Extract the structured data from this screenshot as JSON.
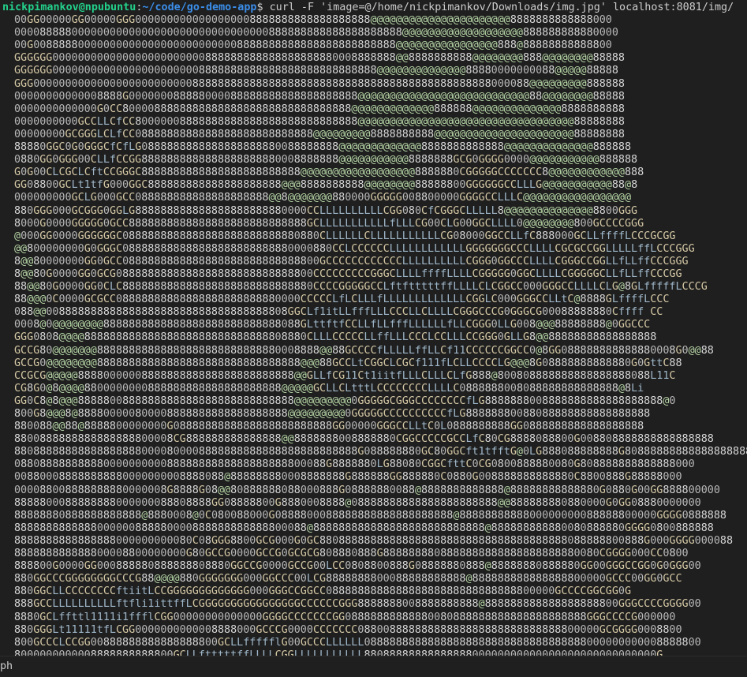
{
  "prompt": {
    "user_host": "nickpimankov@npubuntu",
    "colon": ":",
    "path": "~/code/go-demo-app",
    "dollar": "$",
    "command": " curl -F 'image=@/home/nickpimankov/Downloads/img.jpg' localhost:8081/img/"
  },
  "ascii_art": [
    "00GG00000GG00000GGG0000000000000000008888888888888888888@@@@@@@@@@@@@@@@@@@@@@8888888888888000",
    "0000888880000000000000000000000000000000888888888888888888888@@@@@@@@@@@@@@@@@@@888888888880000",
    "00G008888800000000000000000000000008888888888888888888888888@@@@@@@@@@@@@@@@888@88888888888800",
    "GGGGGG000000000000000000000000888888888888888888880008888888@@8888888888@@@@@@@@888@@@@@@@@88888",
    "GGGGGG000000000000000000000008888888888888888888888888888@@@@@@@@@@@@@@88880000000088@@@@@88888",
    "GGG000000000000000000000000088888888888888888888888888888888888888888888888000088@@@@@@@@@888888",
    "00000000000008888G000000088888000088888888888888888888@@@@@@@@@@@@@@@@@@@@@@@@@@@88@@@@@@@@88888",
    "0000000000000G0CC800008888888888888888888888888888888@@@@@@@@@@@@@888888@@@@@@@@@@@@@@8888888888",
    "0000000000GCCLLCfCC80000008888888888888888888888888888@@@@@@@@@@@@@@@@@@@@@@@@@@@@@@@@@@88888888",
    "00000000GCGGGLCLfCC0888888888888888888888888888@@@@@@@@@8888888888@@@@@@@@@@@@@@@@@@@@@@88888888",
    "88880GGC0G0GGGCfCfLG0888888888888888888880088888888@@@@@@@@@@@@@8888888888888@@@@@@@@@@@@@@888888",
    "0880GG0GGG00CLLfCCGG8888888888888888888880008888888@@@@@@@@@@@8888888GCG0GGGG0000@@@@@@@@@@@888888",
    "G0G00CLCGCLCftCCGGGC8888888888888888888888888@@@@@@@@@@@@@@@@@@8888880CGGGGGCCCCCCC8@@@@@@@@@@@@888",
    "GG08800GCLt1tfG000GGC888888888888888888888@@@8888888888@@@@@@@@88888800GGGGGGCCLLLG@@@@@@@@@@@88@8",
    "000000000GCLG000GCC088888888888888888888@@8@@@@@@@880000GGGGG008800000GGGGCCLLLC@@@@@@@@@@@@@@@@@",
    "880GGG000GCGGG0GGLG888888888888888888888880000CCLLLLLLLLLLCGG080CfCGGGCLLLLL8@@@@@@@@@@@@@@8800GGG",
    "8000G0000GGGGG0GCC8888888888888888888888888888GCLLLLLLLLLLLfLLLCG00CLG00GGCLLLL0@@@@@@@@800GCCCCGGG",
    "@000GG0000GGGGGGC0888888888888888888888888880880CLLLLLLCLLLLLLLLLLLCG08000GGCCLLfC888000GCLLffffLCCCGCGG",
    "@@800000000G0GGGC088888888888888888888888880000880CCLCCCCCCLLLLLLLLLLLLGGGGGGGCCCLLLLCGCGCCGGLLLLLffLCCCGGG",
    "8@@80000000GG0GCC0888888888888888888888888888800GCCCCCCCCCCCCLLLLLLLLLLCGGG0GGCCCLLLLCGGGCCGGLLfLLffCCCGGG",
    "8@@80G0000GG0GCG0888888888888888888888888888800CCCCCCCCCGGGCLLLLffffLLLLCGGGGG0GGCLLLLCGGGGGCLLfLLffCCCGG",
    "88@@80G0000GG0CLC888888888888888888888888888880CCCCGGGGGCCLftftttttffLLLLCLCGGCC000GGGCCLLLLCLG@8GLfffffLCCCG",
    "88@@@0C0000GCGCC08888888888888888888888880000CCCCCLfLCLLLfLLLLLLLLLLLLLCGGLC000GGGCCLLtC@8888GLffffLCCC",
    "088@@00888888888888888888888888888888888808GGCLf1itLLfffLLLCCCLLCLLLLCGGGCCCG0GGGCG00088888880Cffff CC",
    "0008@0@@@@@@@@8888888888888888888888888888088GLttftfCCLLfLLfffLLLLLLfLLCGGG0LLG008@@@88888888@0GGCCC",
    "GGG0808@@@@88888888888888888888888888888808880CLLLCCCCCLLffLLLCCCLCCLLLCCGGG0GLLG8@@88888888888888888",
    "GCCG80@@@@@@@88888888888888888888888888880008888@@88GCCCCfLLLLLffLLCf11CCCCCCGGCC0@8GG088888888888880008G0@@88",
    "GCCG0@@@@@@@@88888888888888888888888888888888@@@88GCCLtCGGCLCGCf111fLCLLCCCCLG@@@8G08888888888880G0GttC88",
    "CCGCG@@@@@8888000000888888888888888888888888@@GLLfCG11Ct1iitfLLLCLLLCLfG888@800808888888888888888088L11C",
    "CG8G0@8@@@@8800000000888888888888888888888@@@@@GCLLCLtttLCCCCCCCCLLLLC0888888008088888888888888@8Li",
    "GG0C8@8@@@8888800888888888888888888888888888@@@@@@@@@0GGGGGCGGGCCCCCCCCfLG8888888008888888888888888888@0",
    "800G8@@@8@888800000800008888888888888888888@@@@@@@@@0GGGGGCCCCCCCCCCfLG88888880088088888888888888888",
    "880088@@88@8888800000000G0888888888888888888888888GG00000GGGCCLLtC0L0888888888GG0888888888888888888",
    "8800888888888888888800008CG888888888888888@@8888888008888880CGGCCCCCGCCLfC80CG8888088800G008808888888888888888",
    "880888888888888888880000800008888888888888888888888888G088888880GC80GGCft1tfftG@0LG888088888888G80888888888888888888",
    "0880888888888800000000008888888888888888888800088G8888880LG88080CGGCfttC0CG0800888880080G808888888888888000",
    "008800088888888880000000008888088@888888880008888888G888888GG888880C0880G008888888888880C8800888G88888000",
    "000088008888888880000008G8888G08@@80888888088000888G08888880088@8888888888888@88888888888880G0880G00GG888800000",
    "8888800088888888000000088808888GG08888800G8880008888@08888888888888888888888@@888888880880000G0GG08880000000",
    "88888880888888888888@8880008@0C080088000G0888800088888888888888888888@8888888888800000000088888800000GGGG0888888",
    "8888888888888000000888880000888888888888800088@888888888888888888888888888@888888888880080888880GGGG0800888888",
    "8888888888888888000000000080C08GGG8800GCG000G0GC880888888888888888888888888888888888888088888800888G000GGGG000088",
    "888888888888800008800000000G80GCCG0000GCCG0GCGCG808880888G8888888808888888888888888888880080CGGGG000CC0800",
    "888800G0000GG000888880888888808880GGCCG0000GCCG00LCC0808800888G08888880888@88888880888880GG00GGGCCGG0G0GGG00",
    "880GGCCCGGGGGGGGCCCG88@@@@880GGGGGGG000GGCCC00LCG8888888800088888888888@888888888888888800000GCCC00GG0GCC",
    "880GGCLLCCCCCCCCftiitLCCGGGGGGGGGGGGG000GGGCCGGCC088888888888888888888888888888800000GCCCCGGCGG0G",
    "888GCCLLLLLLLLLLftfli1ittffLCGGGGGGGGGGGGGGGGCCCCCCGGG8888888008888888888@888888888888888888800GGGCCCCGGGG00",
    "8880GCLffttl1111i1ffflCGG00000000000000GGGGCCCCCCCGG08888888888880080888888888888888888888GGGCCCCG000000",
    "880GGGLt11111tfLCGG0000000000008888000GCCCG0000CCCCCCC08800888888888888888888888888888800000GCGGGG0008800",
    "800GCCCLCCGG00888888888888888800GCLLffffflG00GCCCLLLLLL08888888888888888888888888888888888000000000008888800",
    "8000000000008888888888800GCLLftttttffLLLLCGGLLLLLLLLLLL8808888888888888800000000000000000000000000000G",
    "0000000000000880000GCLftt11111ttfffLLLLCCCCLLLLLLLLLLLffC80088888888888000088888888888888888800000000000000"
  ],
  "status": {
    "text": "ph"
  },
  "colors": {
    "background": "#1f1f1f",
    "prompt_user": "#23d18b",
    "prompt_path": "#3b8eea",
    "text": "#cccccc"
  }
}
